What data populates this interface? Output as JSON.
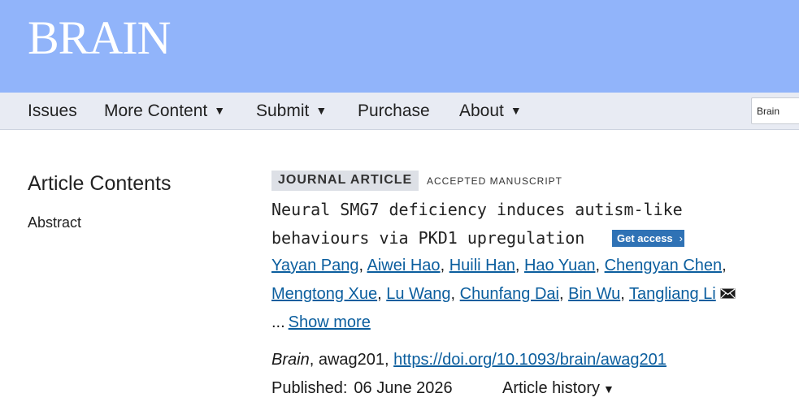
{
  "header": {
    "logo": "BRAIN",
    "background": "#91b4fa"
  },
  "nav": {
    "items": [
      {
        "label": "Issues",
        "dropdown": false
      },
      {
        "label": "More Content",
        "dropdown": true
      },
      {
        "label": "Submit",
        "dropdown": true
      },
      {
        "label": "Purchase",
        "dropdown": false
      },
      {
        "label": "About",
        "dropdown": true
      }
    ],
    "caret": "▼",
    "search_scope": "Brain"
  },
  "sidebar": {
    "title": "Article Contents",
    "links": [
      "Abstract"
    ]
  },
  "article": {
    "type_badge": "JOURNAL ARTICLE",
    "status_badge": "ACCEPTED MANUSCRIPT",
    "title_line1": "Neural SMG7 deficiency induces autism-like",
    "title_line2": "behaviours via PKD1 upregulation",
    "get_access": "Get access",
    "get_access_chevron": "›",
    "authors_line1": [
      "Yayan Pang",
      "Aiwei Hao",
      "Huili Han",
      "Hao Yuan",
      "Chengyan Chen"
    ],
    "authors_line2": [
      "Mengtong Xue",
      "Lu Wang",
      "Chunfang Dai",
      "Bin Wu",
      "Tangliang Li"
    ],
    "separator": ", ",
    "trailing_comma": ",",
    "ellipsis": "...",
    "show_more": "Show more",
    "journal": "Brain",
    "article_id": ", awag201, ",
    "doi": "https://doi.org/10.1093/brain/awag201",
    "published_label": "Published:",
    "published_date": "06 June 2026",
    "history_label": "Article history",
    "history_caret": "▼",
    "link_color": "#0b5e9e",
    "access_button_color": "#2f72b5"
  }
}
